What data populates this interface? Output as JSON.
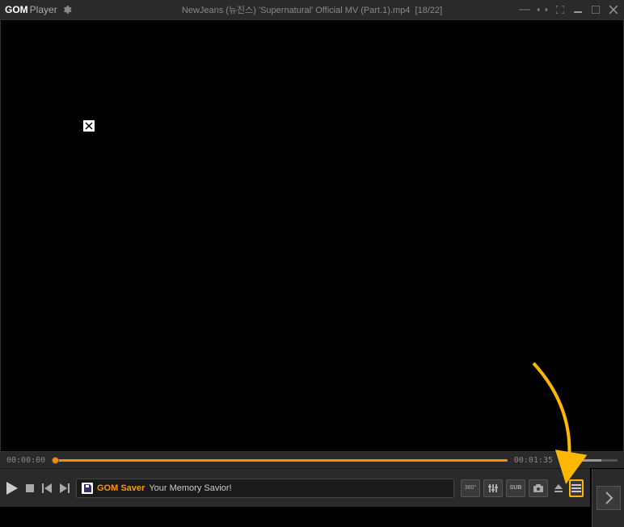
{
  "titlebar": {
    "logo_gom": "GOM",
    "logo_player": "Player",
    "file_title": "NewJeans (뉴진스) 'Supernatural' Official MV (Part.1).mp4",
    "playlist_position": "[18/22]"
  },
  "seek": {
    "current_time": "00:00:00",
    "total_time": "00:01:35"
  },
  "info": {
    "accent_text": "GOM Saver",
    "message": "Your Memory Savior!"
  },
  "buttons": {
    "vr360": "360°",
    "equalizer": "⎚",
    "sub": "SUB",
    "camera": "◉"
  },
  "colors": {
    "accent": "#ff8c00",
    "highlight": "#ffb800",
    "bg": "#2a2a2a"
  }
}
